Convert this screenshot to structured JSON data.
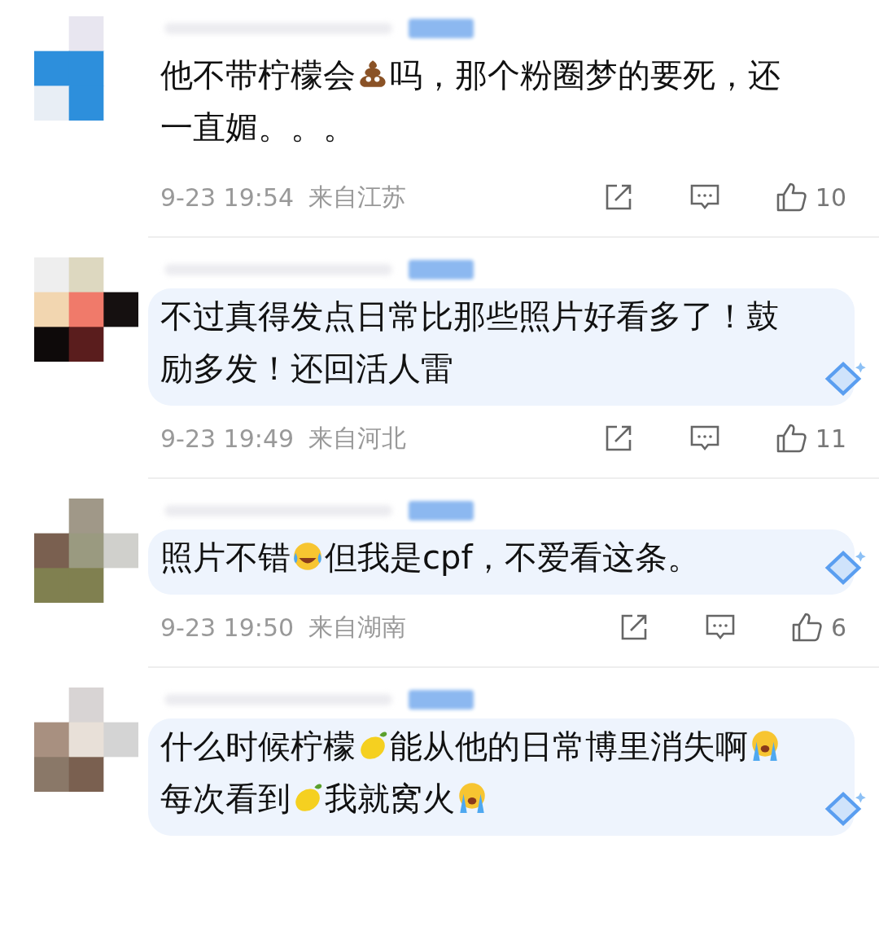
{
  "comments": [
    {
      "bubble": false,
      "content": [
        {
          "kind": "text",
          "text": "他不带柠檬会"
        },
        {
          "kind": "poop"
        },
        {
          "kind": "text",
          "text": "吗，那个粉圈梦的要死，还一直媚。。。"
        }
      ],
      "date": "9-23 19:54",
      "location": "来自江苏",
      "likes": "10"
    },
    {
      "bubble": true,
      "content": [
        {
          "kind": "text",
          "text": "不过真得发点日常比那些照片好看多了！鼓励多发！还回活人雷"
        }
      ],
      "date": "9-23 19:49",
      "location": "来自河北",
      "likes": "11"
    },
    {
      "bubble": true,
      "content": [
        {
          "kind": "text",
          "text": "照片不错"
        },
        {
          "kind": "laugh"
        },
        {
          "kind": "text",
          "text": "但我是cpf，不爱看这条。"
        }
      ],
      "date": "9-23 19:50",
      "location": "来自湖南",
      "likes": "6"
    },
    {
      "bubble": true,
      "content": [
        {
          "kind": "text",
          "text": "什么时候柠檬"
        },
        {
          "kind": "lemon"
        },
        {
          "kind": "text",
          "text": "能从他的日常博里消失啊"
        },
        {
          "kind": "cry"
        },
        {
          "kind": "text",
          "text": " 每次看到"
        },
        {
          "kind": "lemon"
        },
        {
          "kind": "text",
          "text": "我就窝火"
        },
        {
          "kind": "cry"
        }
      ]
    }
  ]
}
